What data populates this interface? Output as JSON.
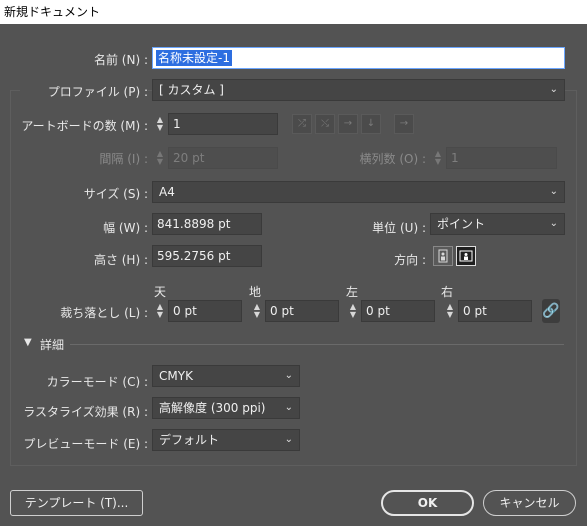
{
  "window": {
    "title": "新規ドキュメント"
  },
  "name": {
    "label": "名前 (N) :",
    "value": "名称未設定-1"
  },
  "profile": {
    "label": "プロファイル (P) :",
    "value": "[ カスタム ]"
  },
  "artboards": {
    "label": "アートボードの数 (M) :",
    "value": "1",
    "spacing_label": "間隔 (I) :",
    "spacing_value": "20 pt",
    "columns_label": "横列数 (O) :",
    "columns_value": "1"
  },
  "size": {
    "label": "サイズ (S) :",
    "value": "A4"
  },
  "width": {
    "label": "幅 (W) :",
    "value": "841.8898 pt"
  },
  "units": {
    "label": "単位 (U) :",
    "value": "ポイント"
  },
  "height": {
    "label": "高さ (H) :",
    "value": "595.2756 pt"
  },
  "orientation": {
    "label": "方向 :"
  },
  "bleed": {
    "label": "裁ち落とし (L) :",
    "top_label": "天",
    "top_value": "0 pt",
    "bottom_label": "地",
    "bottom_value": "0 pt",
    "left_label": "左",
    "left_value": "0 pt",
    "right_label": "右",
    "right_value": "0 pt"
  },
  "advanced": {
    "label": "詳細",
    "color_mode_label": "カラーモード (C) :",
    "color_mode_value": "CMYK",
    "raster_label": "ラスタライズ効果 (R) :",
    "raster_value": "高解像度 (300 ppi)",
    "preview_label": "プレビューモード (E) :",
    "preview_value": "デフォルト"
  },
  "buttons": {
    "templates": "テンプレート (T)...",
    "ok": "OK",
    "cancel": "キャンセル"
  }
}
